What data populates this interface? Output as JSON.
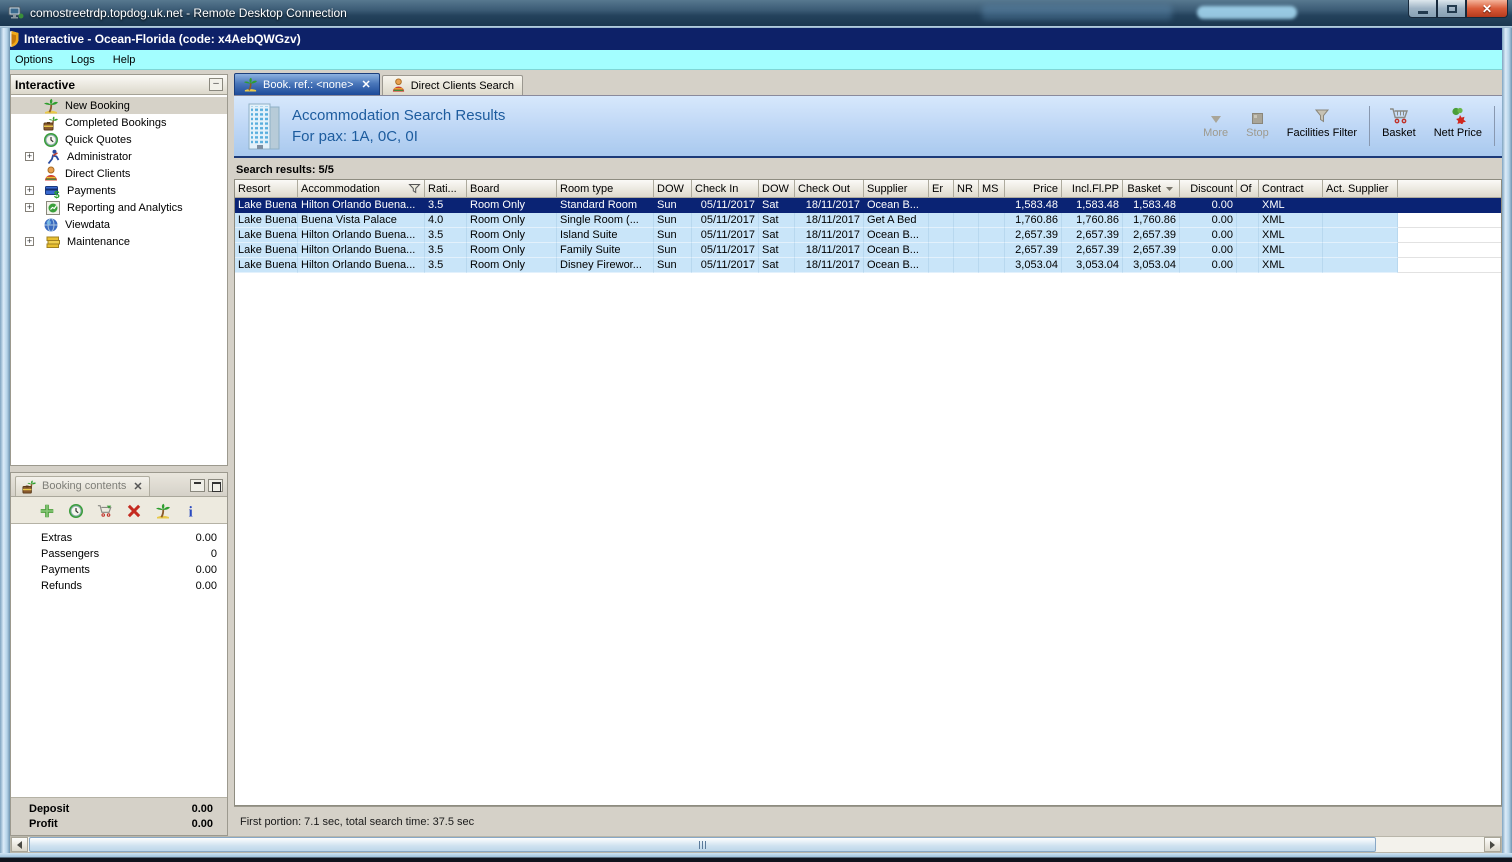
{
  "rdp": {
    "title": "comostreetrdp.topdog.uk.net - Remote Desktop Connection"
  },
  "app": {
    "title": "Interactive - Ocean-Florida (code: x4AebQWGzv)",
    "menu": [
      "Options",
      "Logs",
      "Help"
    ]
  },
  "sidebar": {
    "title": "Interactive",
    "items": [
      {
        "label": "New Booking",
        "icon": "palm-tree-icon",
        "expandable": false,
        "selected": true
      },
      {
        "label": "Completed Bookings",
        "icon": "completed-bookings-icon",
        "expandable": false
      },
      {
        "label": "Quick Quotes",
        "icon": "clock-icon",
        "expandable": false
      },
      {
        "label": "Administrator",
        "icon": "administrator-icon",
        "expandable": true
      },
      {
        "label": "Direct Clients",
        "icon": "person-icon",
        "expandable": false
      },
      {
        "label": "Payments",
        "icon": "payments-icon",
        "expandable": true
      },
      {
        "label": "Reporting and Analytics",
        "icon": "report-icon",
        "expandable": true
      },
      {
        "label": "Viewdata",
        "icon": "globe-icon",
        "expandable": false
      },
      {
        "label": "Maintenance",
        "icon": "maintenance-icon",
        "expandable": true
      }
    ]
  },
  "booking_panel": {
    "title": "Booking contents",
    "toolbar_icons": [
      "add-icon",
      "quick-quote-icon",
      "basket-add-icon",
      "delete-icon",
      "palm-tree-icon",
      "info-icon"
    ],
    "rows": [
      {
        "label": "Extras",
        "value": "0.00"
      },
      {
        "label": "Passengers",
        "value": "0"
      },
      {
        "label": "Payments",
        "value": "0.00"
      },
      {
        "label": "Refunds",
        "value": "0.00"
      }
    ],
    "footer": [
      {
        "label": "Deposit",
        "value": "0.00"
      },
      {
        "label": "Profit",
        "value": "0.00"
      }
    ]
  },
  "tabs": [
    {
      "label": "Book. ref.: <none>",
      "active": true
    },
    {
      "label": "Direct Clients Search",
      "active": false
    }
  ],
  "results_header": {
    "title": "Accommodation Search Results",
    "subtitle": "For pax: 1A, 0C, 0I"
  },
  "toolbar": {
    "more_label": "More",
    "stop_label": "Stop",
    "facilities_filter_label": "Facilities Filter",
    "basket_label": "Basket",
    "nett_price_label": "Nett Price"
  },
  "search_results_label": "Search results: 5/5",
  "grid": {
    "columns": [
      "Resort",
      "Accommodation",
      "Rati...",
      "Board",
      "Room type",
      "DOW",
      "Check In",
      "DOW",
      "Check Out",
      "Supplier",
      "Er",
      "NR",
      "MS",
      "Price",
      "Incl.Fl.PP",
      "Basket",
      "Discount",
      "Of",
      "Contract",
      "Act. Supplier"
    ],
    "selected_row": 0,
    "rows": [
      [
        "Lake Buena...",
        "Hilton Orlando Buena...",
        "3.5",
        "Room Only",
        "Standard Room",
        "Sun",
        "05/11/2017",
        "Sat",
        "18/11/2017",
        "Ocean B...",
        "",
        "",
        "",
        "1,583.48",
        "1,583.48",
        "1,583.48",
        "0.00",
        "",
        "XML",
        ""
      ],
      [
        "Lake Buena...",
        "Buena Vista Palace",
        "4.0",
        "Room Only",
        "Single Room (...",
        "Sun",
        "05/11/2017",
        "Sat",
        "18/11/2017",
        "Get A Bed",
        "",
        "",
        "",
        "1,760.86",
        "1,760.86",
        "1,760.86",
        "0.00",
        "",
        "XML",
        ""
      ],
      [
        "Lake Buena...",
        "Hilton Orlando Buena...",
        "3.5",
        "Room Only",
        "Island Suite",
        "Sun",
        "05/11/2017",
        "Sat",
        "18/11/2017",
        "Ocean B...",
        "",
        "",
        "",
        "2,657.39",
        "2,657.39",
        "2,657.39",
        "0.00",
        "",
        "XML",
        ""
      ],
      [
        "Lake Buena...",
        "Hilton Orlando Buena...",
        "3.5",
        "Room Only",
        "Family Suite",
        "Sun",
        "05/11/2017",
        "Sat",
        "18/11/2017",
        "Ocean B...",
        "",
        "",
        "",
        "2,657.39",
        "2,657.39",
        "2,657.39",
        "0.00",
        "",
        "XML",
        ""
      ],
      [
        "Lake Buena...",
        "Hilton Orlando Buena...",
        "3.5",
        "Room Only",
        "Disney Firewor...",
        "Sun",
        "05/11/2017",
        "Sat",
        "18/11/2017",
        "Ocean B...",
        "",
        "",
        "",
        "3,053.04",
        "3,053.04",
        "3,053.04",
        "0.00",
        "",
        "XML",
        ""
      ]
    ]
  },
  "status": "First portion: 7.1 sec, total search time: 37.5 sec"
}
